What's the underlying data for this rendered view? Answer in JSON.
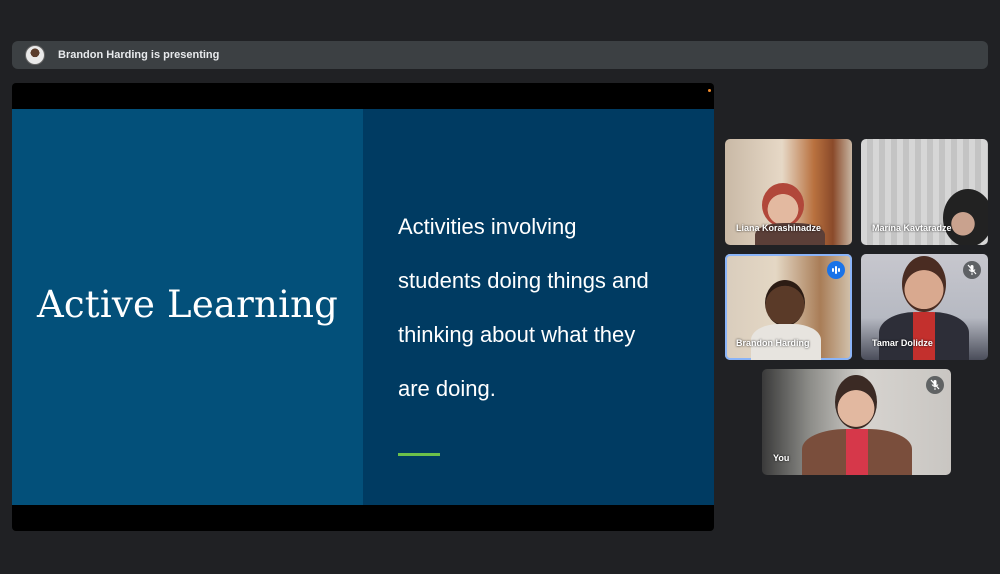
{
  "presenter_bar": {
    "text": "Brandon Harding is presenting"
  },
  "slide": {
    "title": "Active Learning",
    "body_lines": [
      "Activities involving",
      "students doing things and",
      "thinking about what they",
      "are doing."
    ],
    "colors": {
      "left_panel": "#03507a",
      "right_panel": "#003b62",
      "accent": "#6cc04a"
    }
  },
  "participants": [
    {
      "name": "Liana Korashinadze",
      "mic": "on"
    },
    {
      "name": "Marina Kavtaradze",
      "mic": "on"
    },
    {
      "name": "Brandon Harding",
      "mic": "speaking"
    },
    {
      "name": "Tamar Dolidze",
      "mic": "muted"
    },
    {
      "name": "You",
      "mic": "muted"
    }
  ],
  "icons": {
    "mic_muted": "mic-off-icon",
    "speaking": "audio-levels-icon"
  }
}
